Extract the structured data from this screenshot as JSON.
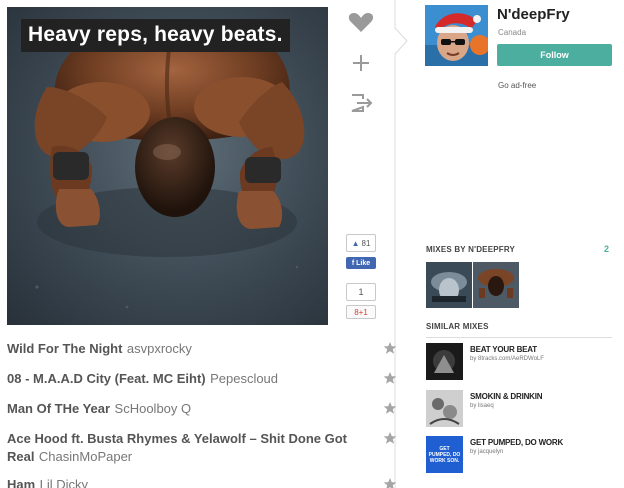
{
  "cover": {
    "caption": "Heavy reps, heavy beats."
  },
  "actions": {
    "icons": [
      "heart-icon",
      "plus-icon",
      "share-icon"
    ]
  },
  "social": {
    "fb_count": "81",
    "fb_like": "Like",
    "gplus_count": "1",
    "gplus_label": "8+1"
  },
  "profile": {
    "name": "N'deepFry",
    "location": "Canada",
    "follow_label": "Follow",
    "adfree_label": "Go ad-free"
  },
  "mixes_by": {
    "heading": "MIXES BY N'DEEPFRY",
    "count": "2"
  },
  "similar": {
    "heading": "SIMILAR MIXES",
    "items": [
      {
        "title": "BEAT YOUR BEAT",
        "by": "by 8tracks.com/AeRDWoLF"
      },
      {
        "title": "SMOKIN & DRINKIN",
        "by": "by lisaeq"
      },
      {
        "title": "GET PUMPED, DO WORK",
        "by": "by jacquelyn",
        "thumb_text": "GET PUMPED, DO WORK SON."
      }
    ]
  },
  "tracks": [
    {
      "name": "Wild For The Night",
      "artist": "asvpxrocky"
    },
    {
      "name": "08 - M.A.A.D City (Feat. MC Eiht)",
      "artist": "Pepescloud"
    },
    {
      "name": "Man Of THe Year",
      "artist": "ScHoolboy Q"
    },
    {
      "name": "Ace Hood ft. Busta Rhymes & Yelawolf – Shit Done Got Real",
      "artist": "ChasinMoPaper"
    },
    {
      "name": "Ham",
      "artist": "Lil Dicky"
    }
  ],
  "colors": {
    "accent": "#4cae9f",
    "facebook": "#4267b2",
    "caption_bg": "#222222"
  }
}
